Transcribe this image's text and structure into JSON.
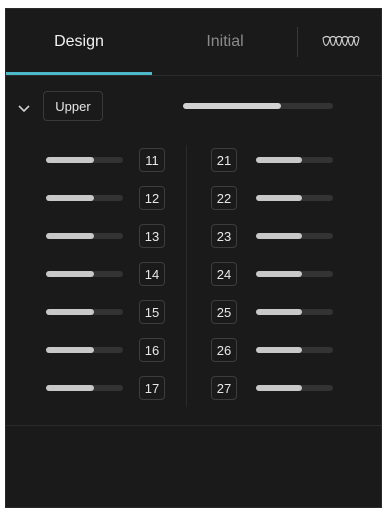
{
  "tabs": {
    "design": "Design",
    "initial": "Initial",
    "teeth_icon": "teeth-icon",
    "active": "design"
  },
  "group": {
    "label": "Upper",
    "expanded": true,
    "master_value": 0.65
  },
  "teeth_left": [
    {
      "number": "11",
      "value": 0.62
    },
    {
      "number": "12",
      "value": 0.62
    },
    {
      "number": "13",
      "value": 0.62
    },
    {
      "number": "14",
      "value": 0.62
    },
    {
      "number": "15",
      "value": 0.62
    },
    {
      "number": "16",
      "value": 0.62
    },
    {
      "number": "17",
      "value": 0.62
    }
  ],
  "teeth_right": [
    {
      "number": "21",
      "value": 0.6
    },
    {
      "number": "22",
      "value": 0.6
    },
    {
      "number": "23",
      "value": 0.6
    },
    {
      "number": "24",
      "value": 0.6
    },
    {
      "number": "25",
      "value": 0.6
    },
    {
      "number": "26",
      "value": 0.6
    },
    {
      "number": "27",
      "value": 0.6
    }
  ],
  "colors": {
    "background": "#1a1a1a",
    "accent": "#4db8c8",
    "slider_fill": "#c8c8c8",
    "slider_track": "#333333"
  }
}
